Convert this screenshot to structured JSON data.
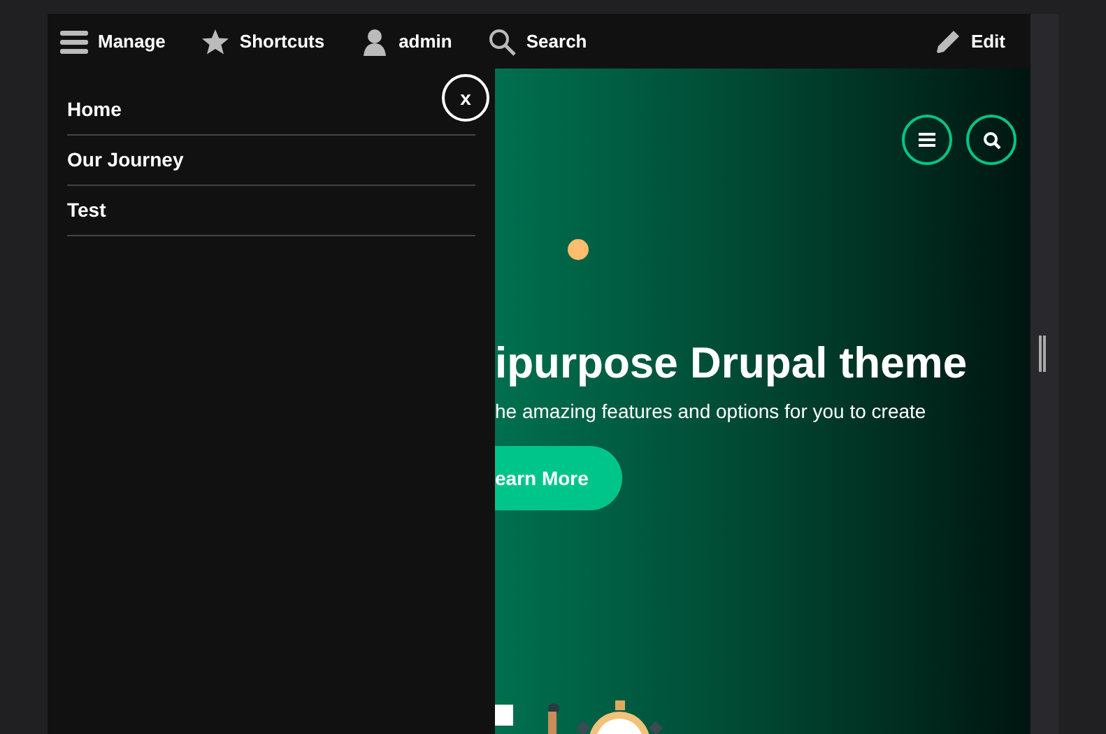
{
  "toolbar": {
    "items": [
      {
        "kind": "menu",
        "label": "Manage"
      },
      {
        "kind": "star",
        "label": "Shortcuts"
      },
      {
        "kind": "user",
        "label": "admin"
      },
      {
        "kind": "search",
        "label": "Search"
      }
    ],
    "edit": "Edit"
  },
  "side_menu": {
    "close": "x",
    "items": [
      {
        "label": "Home"
      },
      {
        "label": "Our Journey"
      },
      {
        "label": "Test"
      }
    ]
  },
  "hero": {
    "title": "ipurpose Drupal theme",
    "subtitle": "he amazing features and options for you to create",
    "button": "earn More"
  }
}
